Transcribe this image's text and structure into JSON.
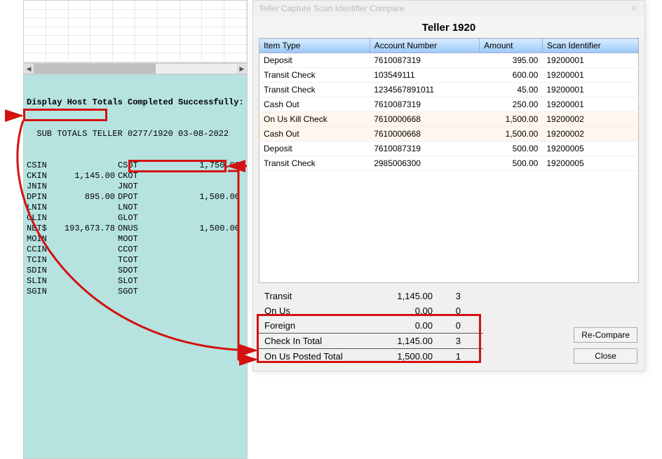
{
  "dialog": {
    "title": "Teller Capture Scan Identifier Compare",
    "teller_title": "Teller 1920"
  },
  "host": {
    "header": "Display Host Totals Completed Successfully:",
    "line1": "  SUB TOTALS TELLER 0277/1920 03-08-2022",
    "rows": [
      {
        "c1": "CSIN",
        "c2": "",
        "c3": "CSOT",
        "c4": "1,750.00"
      },
      {
        "c1": "CKIN",
        "c2": "1,145.00",
        "c3": "CKOT",
        "c4": ""
      },
      {
        "c1": "JNIN",
        "c2": "",
        "c3": "JNOT",
        "c4": ""
      },
      {
        "c1": "DPIN",
        "c2": "895.00",
        "c3": "DPOT",
        "c4": "1,500.00"
      },
      {
        "c1": "LNIN",
        "c2": "",
        "c3": "LNOT",
        "c4": ""
      },
      {
        "c1": "GLIN",
        "c2": "",
        "c3": "GLOT",
        "c4": ""
      },
      {
        "c1": "NET$",
        "c2": "193,673.78",
        "c3": "ONUS",
        "c4": "1,500.00"
      },
      {
        "c1": "MOIN",
        "c2": "",
        "c3": "MOOT",
        "c4": ""
      },
      {
        "c1": "CCIN",
        "c2": "",
        "c3": "CCOT",
        "c4": ""
      },
      {
        "c1": "TCIN",
        "c2": "",
        "c3": "TCOT",
        "c4": ""
      },
      {
        "c1": "SDIN",
        "c2": "",
        "c3": "SDOT",
        "c4": ""
      },
      {
        "c1": "SLIN",
        "c2": "",
        "c3": "SLOT",
        "c4": ""
      },
      {
        "c1": "SGIN",
        "c2": "",
        "c3": "SGOT",
        "c4": ""
      }
    ]
  },
  "table": {
    "headers": {
      "type": "Item Type",
      "acct": "Account Number",
      "amt": "Amount",
      "scan": "Scan Identifier"
    },
    "rows": [
      {
        "type": "Deposit",
        "acct": "7610087319",
        "amt": "395.00",
        "scan": "19200001",
        "alt": false
      },
      {
        "type": "Transit Check",
        "acct": "103549111",
        "amt": "600.00",
        "scan": "19200001",
        "alt": false
      },
      {
        "type": "Transit Check",
        "acct": "1234567891011",
        "amt": "45.00",
        "scan": "19200001",
        "alt": false
      },
      {
        "type": "Cash Out",
        "acct": "7610087319",
        "amt": "250.00",
        "scan": "19200001",
        "alt": false
      },
      {
        "type": "On Us Kill Check",
        "acct": "7610000668",
        "amt": "1,500.00",
        "scan": "19200002",
        "alt": true
      },
      {
        "type": "Cash Out",
        "acct": "7610000668",
        "amt": "1,500.00",
        "scan": "19200002",
        "alt": true
      },
      {
        "type": "Deposit",
        "acct": "7610087319",
        "amt": "500.00",
        "scan": "19200005",
        "alt": false
      },
      {
        "type": "Transit Check",
        "acct": "2985006300",
        "amt": "500.00",
        "scan": "19200005",
        "alt": false
      }
    ]
  },
  "summary": [
    {
      "label": "Transit",
      "val": "1,145.00",
      "count": "3",
      "tot": false
    },
    {
      "label": "On Us",
      "val": "0.00",
      "count": "0",
      "tot": false
    },
    {
      "label": "Foreign",
      "val": "0.00",
      "count": "0",
      "tot": false
    },
    {
      "label": "Check In Total",
      "val": "1,145.00",
      "count": "3",
      "tot": true
    },
    {
      "label": "On Us Posted Total",
      "val": "1,500.00",
      "count": "1",
      "tot": true
    }
  ],
  "buttons": {
    "recompare": "Re-Compare",
    "close": "Close"
  }
}
